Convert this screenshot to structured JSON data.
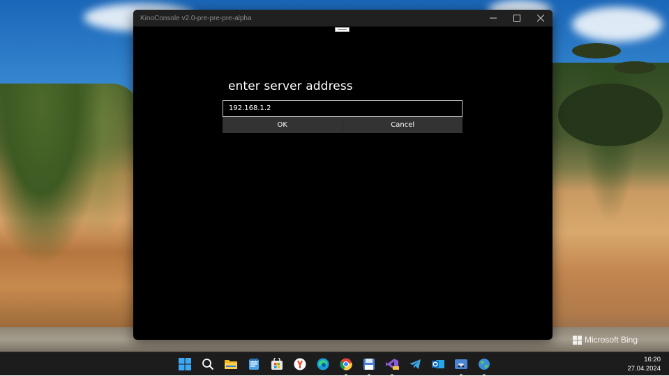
{
  "window": {
    "title": "KinoConsole v2.0-pre-pre-pre-alpha",
    "controls": [
      "minimize-icon",
      "maximize-icon",
      "close-icon"
    ]
  },
  "dialog": {
    "heading": "enter server address",
    "address_value": "192.168.1.2",
    "ok_label": "OK",
    "cancel_label": "Cancel"
  },
  "desktop": {
    "watermark": "Microsoft Bing"
  },
  "taskbar": {
    "apps": [
      {
        "name": "start-icon"
      },
      {
        "name": "search-icon"
      },
      {
        "name": "file-explorer-icon"
      },
      {
        "name": "notepad-icon"
      },
      {
        "name": "microsoft-store-icon"
      },
      {
        "name": "yandex-browser-icon"
      },
      {
        "name": "edge-icon"
      },
      {
        "name": "chrome-icon"
      },
      {
        "name": "save-disk-icon"
      },
      {
        "name": "visual-studio-icon"
      },
      {
        "name": "telegram-icon"
      },
      {
        "name": "outlook-icon"
      },
      {
        "name": "kinoconsole-icon"
      },
      {
        "name": "globe-icon"
      }
    ],
    "time": "16:20",
    "date": "27.04.2024"
  },
  "colors": {
    "window_bg": "#000000",
    "titlebar_bg": "#202020",
    "button_bg": "#333333",
    "taskbar_bg": "#1c1c1c"
  }
}
